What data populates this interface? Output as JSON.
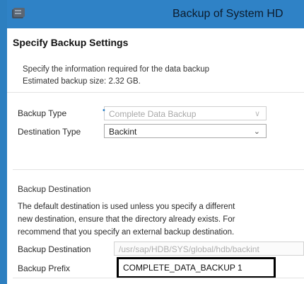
{
  "window": {
    "title": "Backup of System HD"
  },
  "page": {
    "heading": "Specify Backup Settings",
    "description": [
      "Specify the information required for the data backup",
      "Estimated backup size: 2.32 GB."
    ]
  },
  "form": {
    "backup_type": {
      "label": "Backup Type",
      "value": "Complete Data Backup"
    },
    "destination_type": {
      "label": "Destination Type",
      "value": "Backint"
    }
  },
  "destination": {
    "section_title": "Backup Destination",
    "paragraph": [
      "The default destination is used unless you specify a different",
      "new destination, ensure that the directory already exists. For",
      "recommend that you specify an external backup destination."
    ],
    "backup_destination": {
      "label": "Backup Destination",
      "value": "/usr/sap/HDB/SYS/global/hdb/backint"
    },
    "backup_prefix": {
      "label": "Backup Prefix",
      "value": "COMPLETE_DATA_BACKUP 1"
    }
  },
  "colors": {
    "titlebar": "#2f82c6",
    "frame": "#2d7fc0",
    "highlight_border": "#000000"
  },
  "icons": {
    "app": "database-icon",
    "dropdown": "chevron-down-icon"
  }
}
